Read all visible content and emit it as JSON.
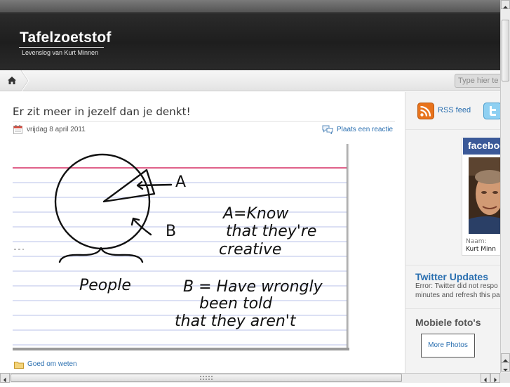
{
  "header": {
    "site_title": "Tafelzoetstof",
    "tagline": "Levenslog van Kurt Minnen"
  },
  "nav": {
    "home_icon": "home-icon",
    "search_placeholder": "Type hier te"
  },
  "post": {
    "title": "Er zit meer in jezelf dan je denkt!",
    "date": "vrijdag 8 april 2011",
    "comment_link": "Plaats een reactie",
    "category": "Goed om weten",
    "drawing": {
      "label_a": "A",
      "label_b": "B",
      "people": "People",
      "a_line1": "A=Know",
      "a_line2": "that they're",
      "a_line3": "creative",
      "b_line1": "B = Have wrongly",
      "b_line2": "been told",
      "b_line3": "that they aren't"
    }
  },
  "sidebar": {
    "rss_label": "RSS feed",
    "facebook_word": "faceboo",
    "facebook_name_label": "Naam:",
    "facebook_name_value": "Kurt Minn",
    "twitter_heading": "Twitter Updates",
    "twitter_error_line1": "Error: Twitter did not respo",
    "twitter_error_line2": "minutes and refresh this pa",
    "photos_heading": "Mobiele foto's",
    "more_photos": "More Photos"
  },
  "colors": {
    "link": "#2a6fb0",
    "facebook": "#3b5998",
    "rss": "#e8731c",
    "twitter": "#5fb6e8"
  }
}
